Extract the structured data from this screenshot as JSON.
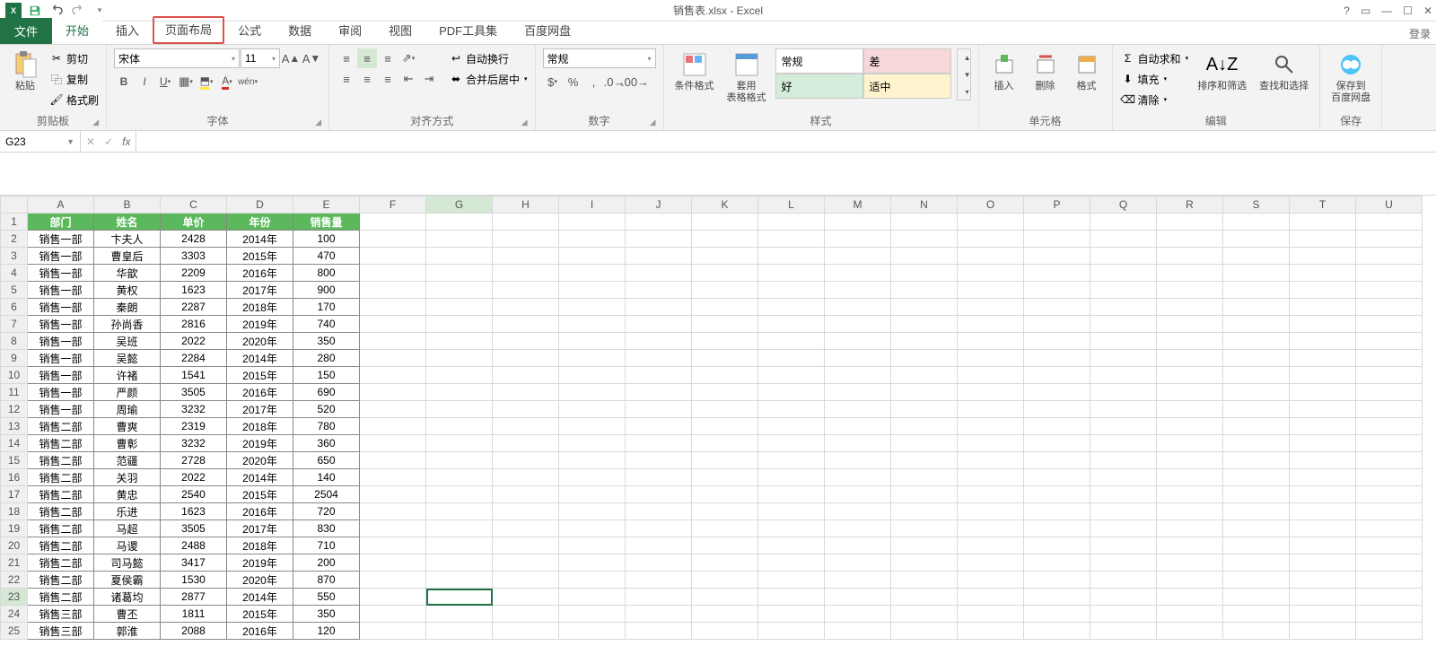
{
  "title": "销售表.xlsx - Excel",
  "login": "登录",
  "file_tab": "文件",
  "tabs": [
    "开始",
    "插入",
    "页面布局",
    "公式",
    "数据",
    "审阅",
    "视图",
    "PDF工具集",
    "百度网盘"
  ],
  "active_tab": 0,
  "highlight_tab": 2,
  "namebox": "G23",
  "ribbon": {
    "clipboard": {
      "paste": "粘贴",
      "cut": "剪切",
      "copy": "复制",
      "fmt": "格式刷",
      "label": "剪贴板"
    },
    "font": {
      "name": "宋体",
      "size": "11",
      "label": "字体"
    },
    "align": {
      "wrap": "自动换行",
      "merge": "合并后居中",
      "label": "对齐方式"
    },
    "number": {
      "fmt": "常规",
      "label": "数字",
      "pct": "%"
    },
    "styles": {
      "cond": "条件格式",
      "table": "套用\n表格格式",
      "normal": "常规",
      "bad": "差",
      "good": "好",
      "neutral": "适中",
      "label": "样式"
    },
    "cells": {
      "insert": "插入",
      "delete": "删除",
      "format": "格式",
      "label": "单元格"
    },
    "editing": {
      "sum": "自动求和",
      "fill": "填充",
      "clear": "清除",
      "sort": "排序和筛选",
      "find": "查找和选择",
      "label": "编辑"
    },
    "save": {
      "baidu": "保存到\n百度网盘",
      "label": "保存"
    }
  },
  "columns_letters": [
    "A",
    "B",
    "C",
    "D",
    "E",
    "F",
    "G",
    "H",
    "I",
    "J",
    "K",
    "L",
    "M",
    "N",
    "O",
    "P",
    "Q",
    "R",
    "S",
    "T",
    "U"
  ],
  "headers": [
    "部门",
    "姓名",
    "单价",
    "年份",
    "销售量"
  ],
  "active_cell": {
    "row": 23,
    "col": "G"
  },
  "rows": [
    [
      "销售一部",
      "卞夫人",
      "2428",
      "2014年",
      "100"
    ],
    [
      "销售一部",
      "曹皇后",
      "3303",
      "2015年",
      "470"
    ],
    [
      "销售一部",
      "华歆",
      "2209",
      "2016年",
      "800"
    ],
    [
      "销售一部",
      "黄权",
      "1623",
      "2017年",
      "900"
    ],
    [
      "销售一部",
      "秦朗",
      "2287",
      "2018年",
      "170"
    ],
    [
      "销售一部",
      "孙尚香",
      "2816",
      "2019年",
      "740"
    ],
    [
      "销售一部",
      "吴班",
      "2022",
      "2020年",
      "350"
    ],
    [
      "销售一部",
      "吴懿",
      "2284",
      "2014年",
      "280"
    ],
    [
      "销售一部",
      "许褚",
      "1541",
      "2015年",
      "150"
    ],
    [
      "销售一部",
      "严颜",
      "3505",
      "2016年",
      "690"
    ],
    [
      "销售一部",
      "周瑜",
      "3232",
      "2017年",
      "520"
    ],
    [
      "销售二部",
      "曹爽",
      "2319",
      "2018年",
      "780"
    ],
    [
      "销售二部",
      "曹彰",
      "3232",
      "2019年",
      "360"
    ],
    [
      "销售二部",
      "范疆",
      "2728",
      "2020年",
      "650"
    ],
    [
      "销售二部",
      "关羽",
      "2022",
      "2014年",
      "140"
    ],
    [
      "销售二部",
      "黄忠",
      "2540",
      "2015年",
      "2504"
    ],
    [
      "销售二部",
      "乐进",
      "1623",
      "2016年",
      "720"
    ],
    [
      "销售二部",
      "马超",
      "3505",
      "2017年",
      "830"
    ],
    [
      "销售二部",
      "马谡",
      "2488",
      "2018年",
      "710"
    ],
    [
      "销售二部",
      "司马懿",
      "3417",
      "2019年",
      "200"
    ],
    [
      "销售二部",
      "夏侯霸",
      "1530",
      "2020年",
      "870"
    ],
    [
      "销售二部",
      "诸葛均",
      "2877",
      "2014年",
      "550"
    ],
    [
      "销售三部",
      "曹丕",
      "1811",
      "2015年",
      "350"
    ],
    [
      "销售三部",
      "郭淮",
      "2088",
      "2016年",
      "120"
    ]
  ]
}
